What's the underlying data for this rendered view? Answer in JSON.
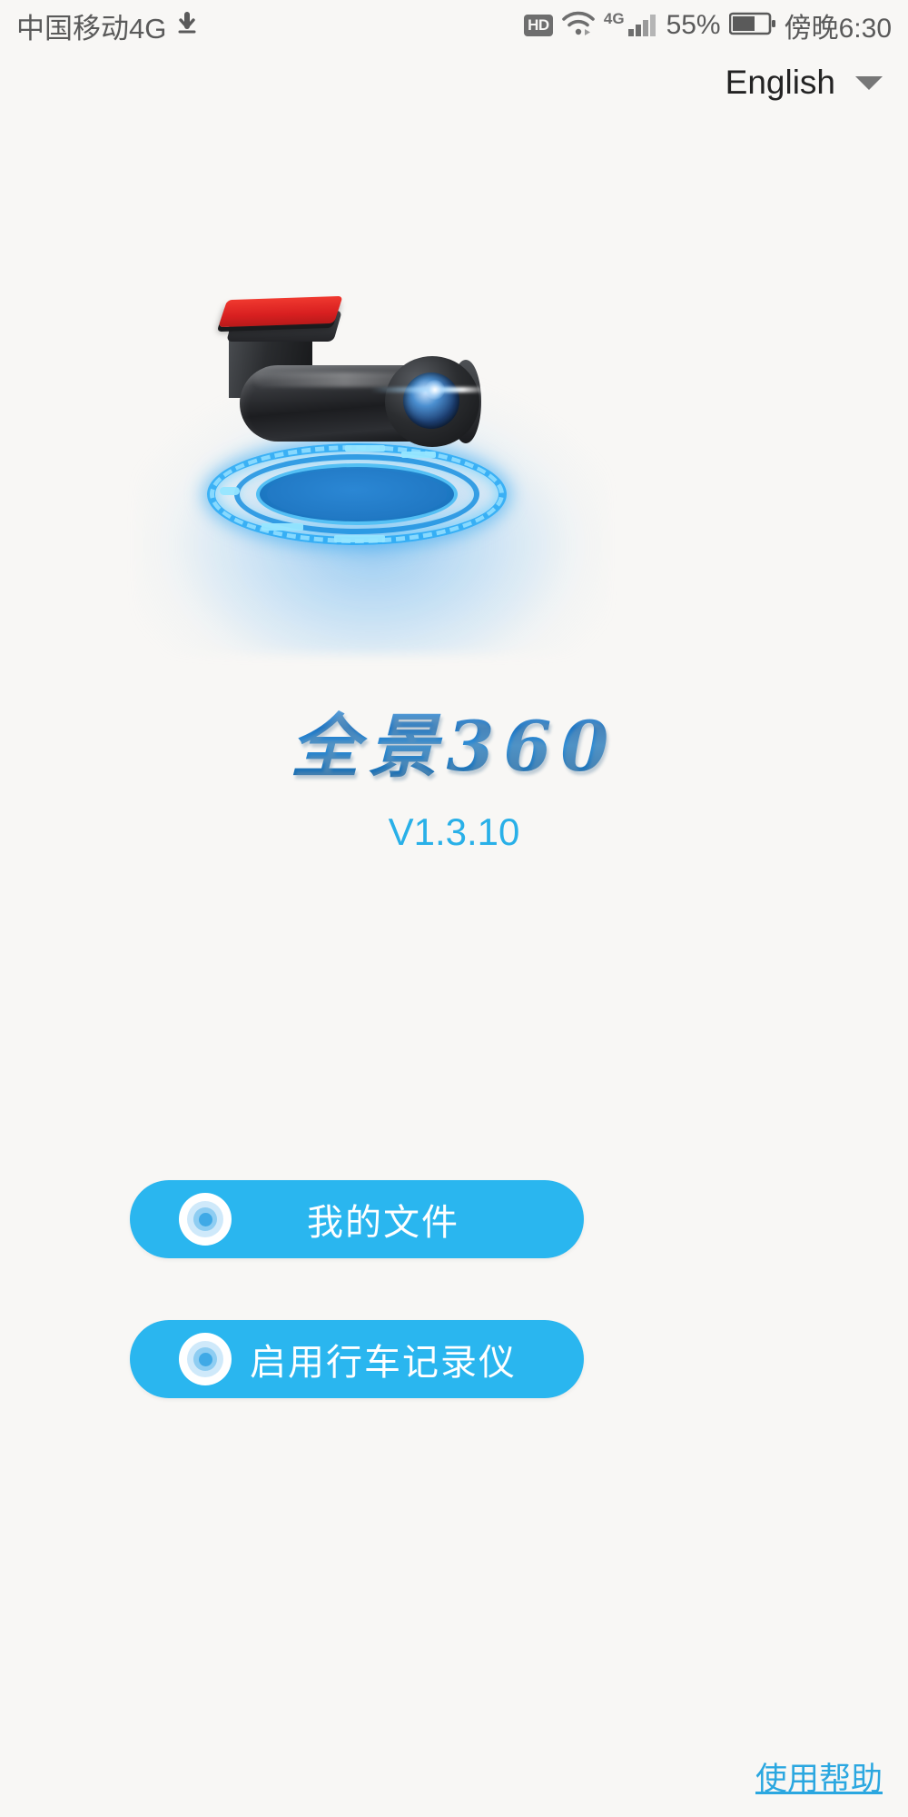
{
  "status_bar": {
    "carrier": "中国移动4G",
    "download_icon": "download-arrow-icon",
    "hd_badge": "HD",
    "wifi_icon": "wifi-icon",
    "network_type": "4G",
    "signal_icon": "signal-bars-icon",
    "battery_percent": "55%",
    "battery_icon": "battery-icon",
    "clock": "傍晚6:30"
  },
  "language_selector": {
    "label": "English",
    "caret_icon": "chevron-down-icon"
  },
  "hero": {
    "device_icon": "dashcam-device-image",
    "hud_icon": "hud-ring-platform"
  },
  "brand": {
    "logo_text": "全景360",
    "version": "V1.3.10"
  },
  "buttons": [
    {
      "label": "我的文件",
      "icon": "lens-target-icon"
    },
    {
      "label": "启用行车记录仪",
      "icon": "lens-target-icon"
    }
  ],
  "footer": {
    "help_link": "使用帮助"
  },
  "colors": {
    "background": "#f8f7f5",
    "button_blue": "#2ab6ef",
    "version_blue": "#29b0e8",
    "link_blue": "#2ba7e0",
    "logo_blue": "#1f76c4",
    "accent_red": "#d81f20"
  }
}
